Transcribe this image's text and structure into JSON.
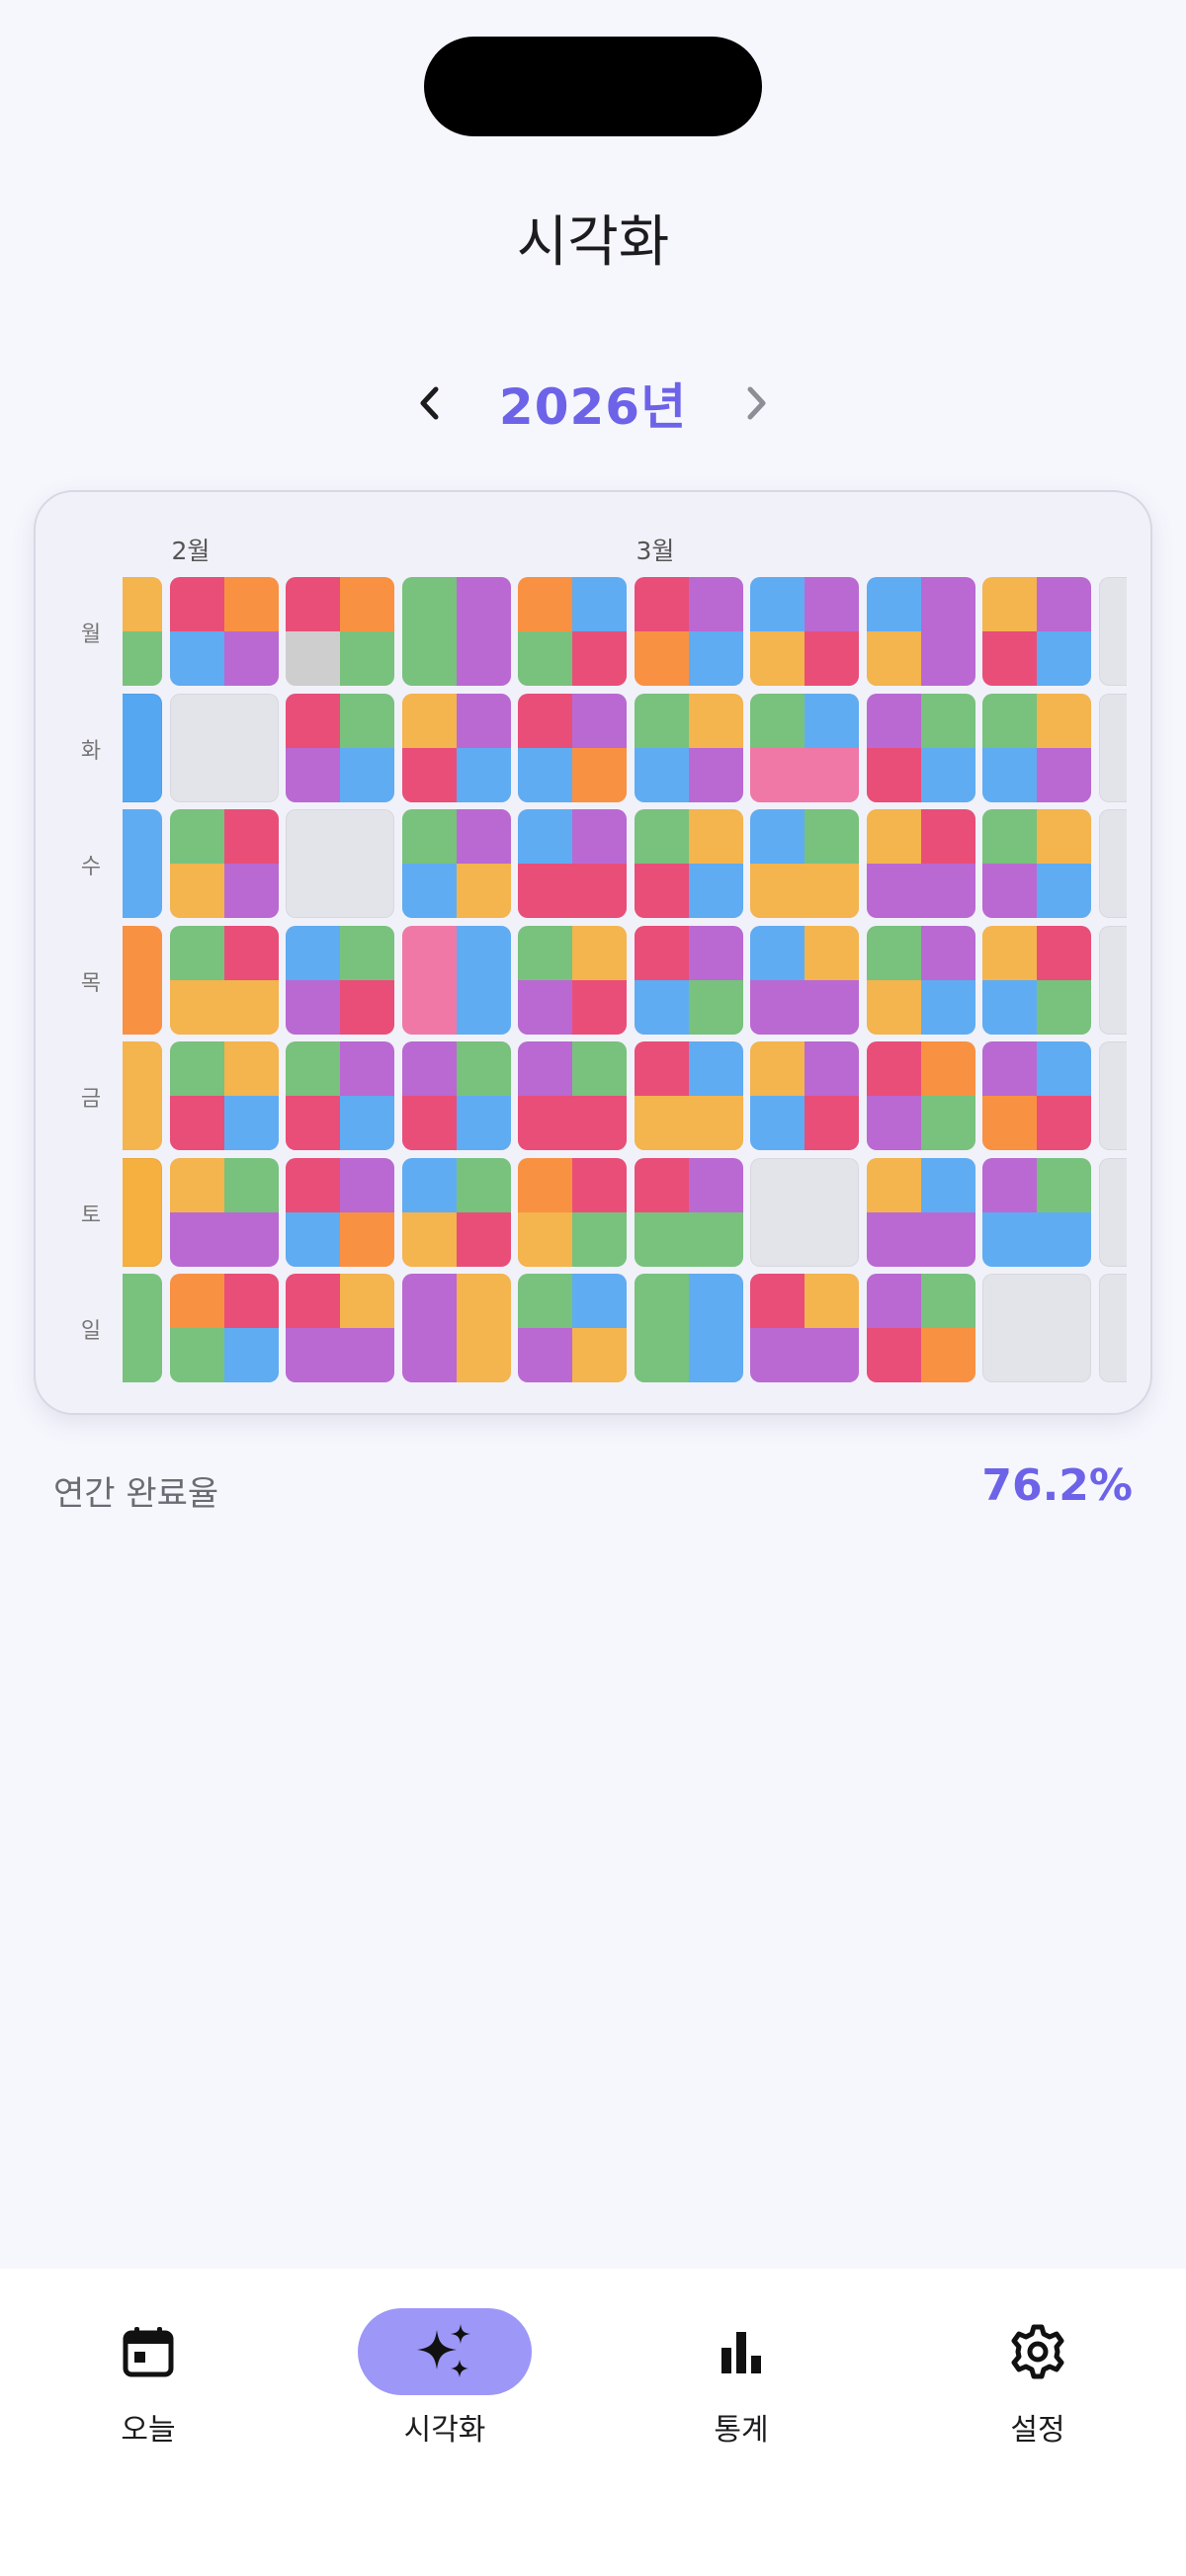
{
  "header": {
    "title": "시각화"
  },
  "year_nav": {
    "year": "2026년"
  },
  "grid": {
    "months": [
      {
        "label": "2월",
        "col": 0
      },
      {
        "label": "3월",
        "col": 4
      }
    ],
    "weekdays": [
      "월",
      "화",
      "수",
      "목",
      "금",
      "토",
      "일"
    ],
    "palette": {
      "r": "#e9416f",
      "o": "#fb8a33",
      "y": "#f5b040",
      "g": "#6fbf73",
      "b": "#55a7f2",
      "p": "#b65ed0",
      "k": "#f06fa0",
      "e": "#e3e3ea"
    },
    "rows": [
      [
        "pyog",
        "robp",
        "roxg",
        "gp",
        "obgr",
        "rpob",
        "bpyr",
        "bpyp",
        "ypr b",
        "e"
      ],
      [
        "b",
        "e",
        "rgpb",
        "yprb",
        "rpbo",
        "gybp",
        "gbkk",
        "pgrb",
        "gybp",
        "e"
      ],
      [
        "yb",
        "gryp",
        "e",
        "gpby",
        "bprr",
        "gyrb",
        "bgyy",
        "yrpp",
        "gypb",
        "e"
      ],
      [
        "ro",
        "gryy",
        "bgpr",
        "kb",
        "gypr",
        "rpbg",
        "bypp",
        "gpyb",
        "yrbg",
        "e"
      ],
      [
        "yy",
        "gyrb",
        "gprb",
        "pgrb",
        "pgrr",
        "rbyy",
        "ypbr",
        "ropg",
        "pbor",
        "e"
      ],
      [
        "y",
        "ygpp",
        "rpbo",
        "bgyr",
        "oryg",
        "rpgg",
        "e",
        "ybpp",
        "pgbb",
        "e"
      ],
      [
        "pg",
        "orgb",
        "rypp",
        "py",
        "gbpy",
        "gb",
        "rypp",
        "pgro",
        "e",
        "e"
      ]
    ]
  },
  "summary": {
    "label": "연간 완료율",
    "value": "76.2%"
  },
  "tabs": [
    {
      "label": "오늘",
      "icon": "calendar-icon"
    },
    {
      "label": "시각화",
      "icon": "sparkles-icon"
    },
    {
      "label": "통계",
      "icon": "bar-chart-icon"
    },
    {
      "label": "설정",
      "icon": "gear-icon"
    }
  ],
  "colors": {
    "accent": "#6d63e8",
    "active_tab": "#9d97f7",
    "background": "#f6f6fd"
  }
}
